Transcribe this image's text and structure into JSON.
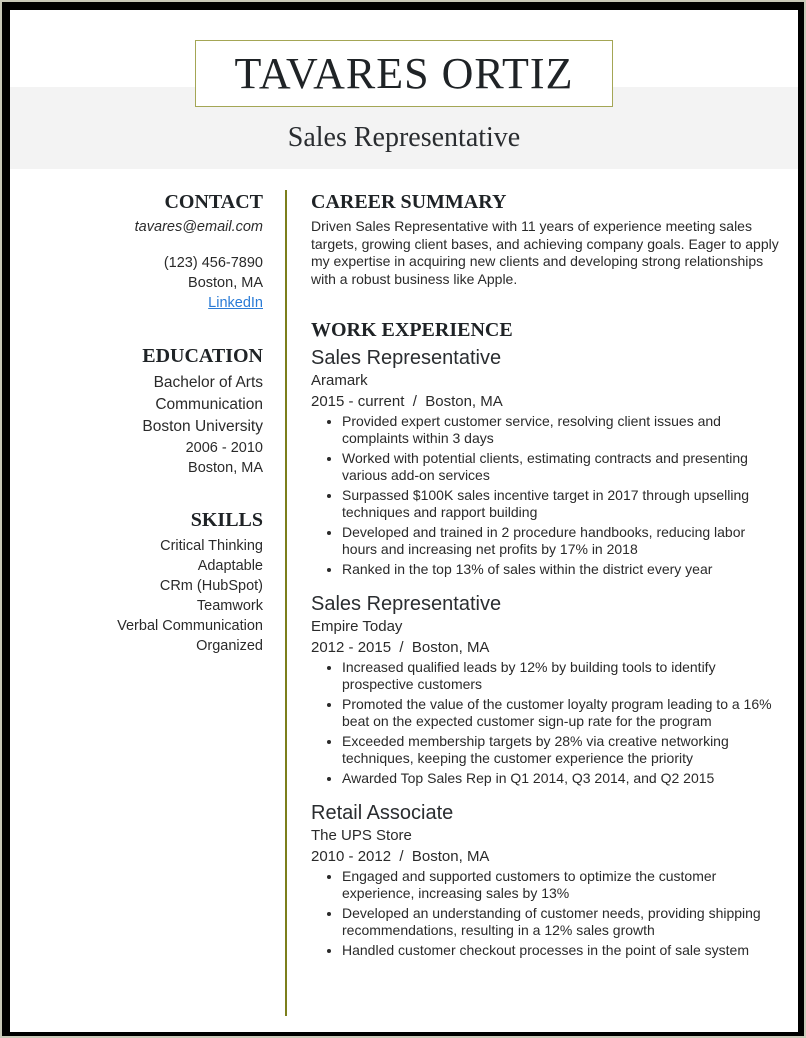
{
  "header": {
    "name": "TAVARES ORTIZ",
    "title": "Sales Representative"
  },
  "contact": {
    "heading": "CONTACT",
    "email": "tavares@email.com",
    "phone": "(123) 456-7890",
    "location": "Boston, MA",
    "linkedin": "LinkedIn"
  },
  "education": {
    "heading": "EDUCATION",
    "degree": "Bachelor of Arts",
    "major": "Communication",
    "school": "Boston University",
    "years": "2006 - 2010",
    "location": "Boston, MA"
  },
  "skills": {
    "heading": "SKILLS",
    "items": [
      "Critical Thinking",
      "Adaptable",
      "CRm (HubSpot)",
      "Teamwork",
      "Verbal Communication",
      "Organized"
    ]
  },
  "summary": {
    "heading": "CAREER SUMMARY",
    "text": "Driven Sales Representative with 11 years of experience meeting sales targets, growing client bases, and achieving company goals. Eager to apply my expertise in acquiring new clients and developing strong relationships with a robust business like Apple."
  },
  "experience": {
    "heading": "WORK EXPERIENCE",
    "jobs": [
      {
        "title": "Sales Representative",
        "company": "Aramark",
        "dates": "2015 - current  /  Boston, MA",
        "bullets": [
          "Provided expert customer service, resolving client issues and complaints within 3 days",
          "Worked with potential clients, estimating contracts and presenting various add-on services",
          "Surpassed $100K sales incentive target in 2017 through upselling techniques and rapport building",
          "Developed and trained in 2 procedure handbooks, reducing labor hours and increasing net profits by 17% in 2018",
          "Ranked in the top 13% of sales within the district every year"
        ]
      },
      {
        "title": "Sales Representative",
        "company": "Empire Today",
        "dates": "2012 - 2015  /  Boston, MA",
        "bullets": [
          "Increased qualified leads by 12% by building tools to identify prospective customers",
          "Promoted the value of the customer loyalty program leading to a 16% beat on the expected customer sign-up rate for the program",
          "Exceeded membership targets by 28% via creative networking techniques, keeping the customer experience the priority",
          "Awarded Top Sales Rep in Q1 2014, Q3 2014, and Q2 2015"
        ]
      },
      {
        "title": "Retail Associate",
        "company": "The UPS Store",
        "dates": "2010 - 2012  /  Boston, MA",
        "bullets": [
          "Engaged and supported customers to optimize the customer experience, increasing sales by 13%",
          "Developed an understanding of customer needs, providing shipping recommendations, resulting in a 12% sales growth",
          "Handled customer checkout processes in the point of sale system"
        ]
      }
    ]
  },
  "colors": {
    "accent": "#7c7f1c",
    "link": "#2a7bd6",
    "band": "#f3f3f3"
  }
}
